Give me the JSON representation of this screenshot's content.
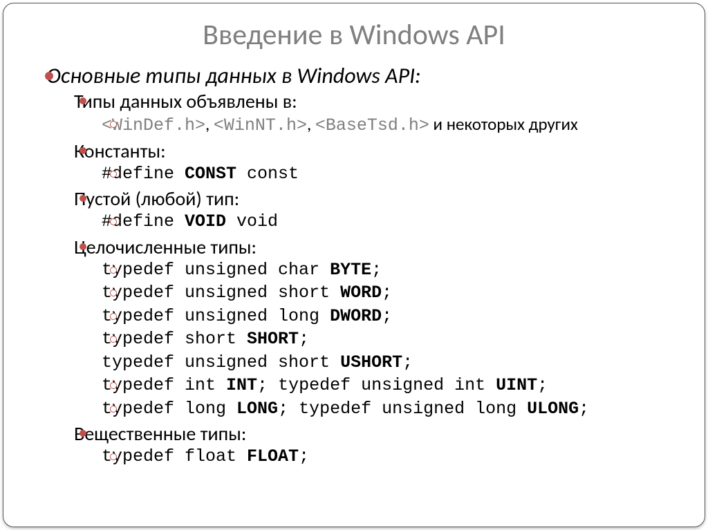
{
  "title": "Введение в Windows API",
  "heading": "Основные типы данных в Windows API:",
  "declaredIn": {
    "label": "Типы данных объявлены в:",
    "h1": "<WinDef.h>",
    "h2": "<WinNT.h>",
    "h3": "<BaseTsd.h>",
    "tail": " и некоторых других"
  },
  "constants": {
    "label": "Константы:",
    "def_pre": "#define ",
    "def_kw": "CONST",
    "def_post": " const"
  },
  "voidType": {
    "label": "Пустой (любой) тип:",
    "def_pre": "#define ",
    "def_kw": "VOID",
    "def_post": " void"
  },
  "ints": {
    "label": "Целочисленные типы:",
    "l1_pre": "typedef unsigned char ",
    "l1_kw": "BYTE",
    "l1_post": ";",
    "l2_pre": "typedef unsigned short ",
    "l2_kw": "WORD",
    "l2_post": ";",
    "l3_pre": "typedef unsigned long ",
    "l3_kw": "DWORD",
    "l3_post": ";",
    "l4_pre": "typedef short ",
    "l4_kw": "SHORT",
    "l4_post": ";",
    "l5_pre": "typedef unsigned short ",
    "l5_kw": "USHORT",
    "l5_post": ";",
    "l6a_pre": "typedef int ",
    "l6a_kw": "INT",
    "l6a_post": "; ",
    "l6b_pre": "typedef unsigned int ",
    "l6b_kw": "UINT",
    "l6b_post": ";",
    "l7a_pre": "typedef long ",
    "l7a_kw": "LONG",
    "l7a_post": ";  ",
    "l7b_pre": "typedef unsigned long ",
    "l7b_kw": "ULONG",
    "l7b_post": ";"
  },
  "floats": {
    "label": "Вещественные типы:",
    "l1_pre": "typedef float ",
    "l1_kw": "FLOAT",
    "l1_post": ";"
  }
}
